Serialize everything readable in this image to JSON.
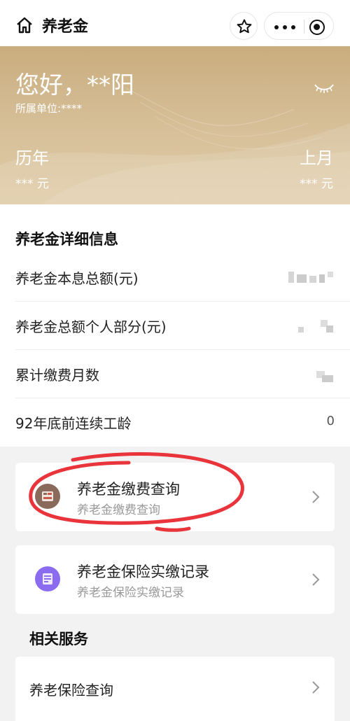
{
  "nav": {
    "title": "养老金",
    "home_icon": "home-icon",
    "star_icon": "star-icon",
    "more_icon": "more-dots-icon",
    "close_icon": "target-icon"
  },
  "banner": {
    "greeting": "您好，**阳",
    "unit": "所属单位:****",
    "eye_icon": "eye-closed-icon",
    "left_label": "历年",
    "left_value": "*** 元",
    "right_label": "上月",
    "right_value": "*** 元"
  },
  "detail": {
    "title": "养老金详细信息",
    "rows": [
      {
        "label": "养老金本息总额(元)",
        "value": ""
      },
      {
        "label": "养老金总额个人部分(元)",
        "value": ""
      },
      {
        "label": "累计缴费月数",
        "value": ""
      },
      {
        "label": "92年底前连续工龄",
        "value": "0"
      }
    ]
  },
  "cards": [
    {
      "title": "养老金缴费查询",
      "subtitle": "养老金缴费查询",
      "icon": "payment-query-icon",
      "color": "#8a6a5a"
    },
    {
      "title": "养老金保险实缴记录",
      "subtitle": "养老金保险实缴记录",
      "icon": "insurance-record-icon",
      "color": "#8b6cf0"
    }
  ],
  "related": {
    "title": "相关服务",
    "items": [
      {
        "label": "养老保险查询"
      }
    ]
  },
  "colors": {
    "banner_gold": "#c9ad7e",
    "annotation_red": "#e8343a"
  }
}
